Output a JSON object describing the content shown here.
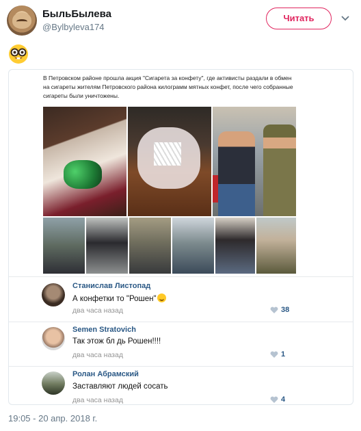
{
  "tweet": {
    "display_name": "БыльБылева",
    "handle": "@Bylbyleva174",
    "follow_label": "Читать",
    "emoji": "nerd-face",
    "timestamp": "19:05 - 20 апр. 2018 г."
  },
  "post": {
    "text": "В Петровском районе прошла акция \"Сигарета за конфету\", где активисты раздали в обмен на сигареты жителям Петровского района килограмм мятных конфет, после чего собранные сигареты были уничтожены."
  },
  "comments": [
    {
      "author": "Станислав Листопад",
      "text": "А конфетки то \"Рошен\"",
      "time": "два часа назад",
      "likes": "38"
    },
    {
      "author": "Semen Stratovich",
      "text": "Так этож бл  дь Рошен!!!!",
      "time": "два часа назад",
      "likes": "1"
    },
    {
      "author": "Ролан Абрамский",
      "text": "Заставляют людей сосать",
      "time": "два часа назад",
      "likes": "4"
    }
  ],
  "colors": {
    "accent": "#e0245e",
    "link": "#2a5885",
    "muted": "#657786"
  }
}
